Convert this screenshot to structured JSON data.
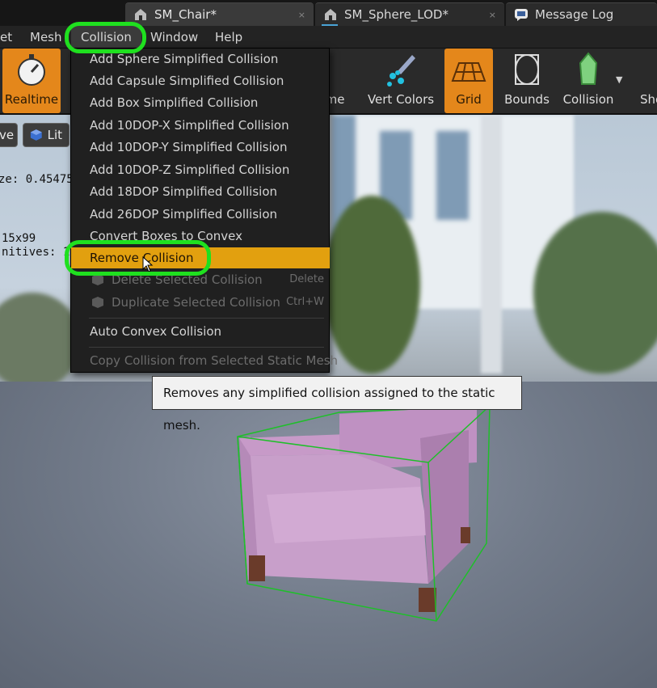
{
  "tabs": [
    {
      "label": "SM_Chair*",
      "icon": "static-mesh-icon",
      "active": true
    },
    {
      "label": "SM_Sphere_LOD*",
      "icon": "static-mesh-icon",
      "active": false
    },
    {
      "label": "Message Log",
      "icon": "message-log-icon",
      "active": false
    }
  ],
  "tab_close_glyph": "×",
  "menubar": {
    "items": [
      "et",
      "Mesh",
      "Collision",
      "Window",
      "Help"
    ],
    "open_item": "Collision"
  },
  "toolbar": {
    "items": [
      {
        "label": "Realtime",
        "icon": "stopwatch-icon",
        "active": true
      },
      {
        "label": "ame",
        "icon": "wireframe-icon",
        "active": false
      },
      {
        "label": "Vert Colors",
        "icon": "vert-colors-icon",
        "active": false
      },
      {
        "label": "Grid",
        "icon": "grid-icon",
        "active": true
      },
      {
        "label": "Bounds",
        "icon": "bounds-icon",
        "active": false
      },
      {
        "label": "Collision",
        "icon": "collision-icon",
        "active": false
      },
      {
        "label": "Sho",
        "icon": "",
        "active": false
      }
    ],
    "accent_color": "#e4871b"
  },
  "viewport": {
    "view_button": "ve",
    "lit_button": "Lit",
    "stats": [
      "ze:  0.454752",
      "15x99",
      "nitives:  1"
    ]
  },
  "collision_menu": {
    "items": [
      {
        "label": "Add Sphere Simplified Collision",
        "enabled": true
      },
      {
        "label": "Add Capsule Simplified Collision",
        "enabled": true
      },
      {
        "label": "Add Box Simplified Collision",
        "enabled": true
      },
      {
        "label": "Add 10DOP-X Simplified Collision",
        "enabled": true
      },
      {
        "label": "Add 10DOP-Y Simplified Collision",
        "enabled": true
      },
      {
        "label": "Add 10DOP-Z Simplified Collision",
        "enabled": true
      },
      {
        "label": "Add 18DOP Simplified Collision",
        "enabled": true
      },
      {
        "label": "Add 26DOP Simplified Collision",
        "enabled": true
      },
      {
        "label": "Convert Boxes to Convex",
        "enabled": true
      },
      {
        "label": "Remove Collision",
        "enabled": true,
        "highlighted": true
      },
      {
        "label": "Delete Selected Collision",
        "enabled": false,
        "shortcut": "Delete"
      },
      {
        "label": "Duplicate Selected Collision",
        "enabled": false,
        "shortcut": "Ctrl+W"
      },
      {
        "label": "Auto Convex Collision",
        "enabled": true
      },
      {
        "label": "Copy Collision from Selected Static Mesh",
        "enabled": false
      }
    ],
    "highlight_color": "#e2a00f"
  },
  "tooltip": "Removes any simplified collision assigned to the static mesh.",
  "annotation_color": "#1fe01f"
}
